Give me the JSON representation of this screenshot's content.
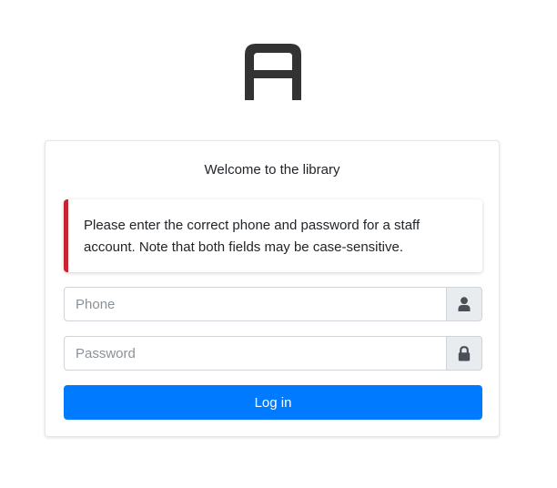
{
  "colors": {
    "accent": "#007bff",
    "alert_border": "#c82333",
    "logo": "#333333",
    "addon_bg": "#e9ecef"
  },
  "logo": {
    "icon": "logo-a-icon"
  },
  "card": {
    "title": "Welcome to the library",
    "alert": {
      "text": "Please enter the correct phone and password for a staff account. Note that both fields may be case-sensitive."
    },
    "phone": {
      "placeholder": "Phone",
      "value": "",
      "icon": "user-icon"
    },
    "password": {
      "placeholder": "Password",
      "value": "",
      "icon": "lock-icon"
    },
    "login_label": "Log in"
  }
}
